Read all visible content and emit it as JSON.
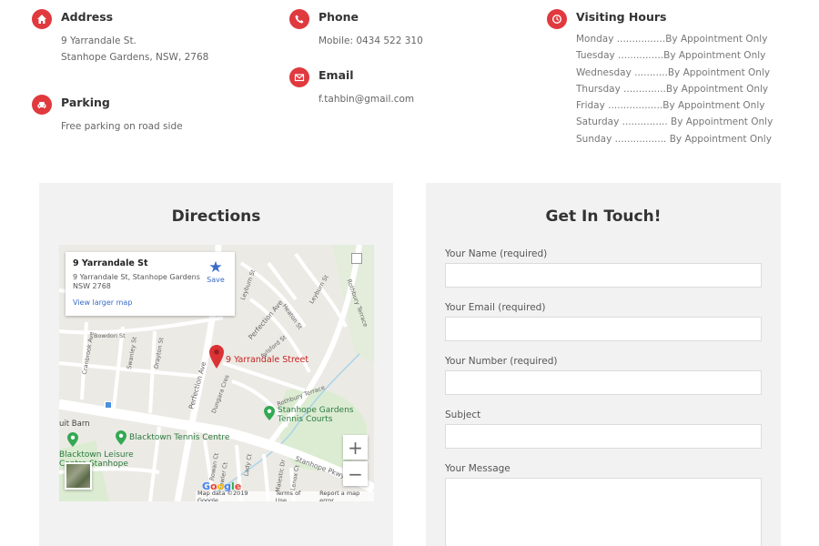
{
  "address": {
    "title": "Address",
    "lines": [
      "9 Yarrandale St.",
      "Stanhope Gardens, NSW, 2768"
    ]
  },
  "parking": {
    "title": "Parking",
    "text": "Free parking on road side"
  },
  "phone": {
    "title": "Phone",
    "text": "Mobile: 0434 522 310"
  },
  "email": {
    "title": "Email",
    "text": "f.tahbin@gmail.com"
  },
  "hours": {
    "title": "Visiting Hours",
    "rows": [
      "Monday ................By Appointment Only",
      "Tuesday ...............By Appointment Only",
      "Wednesday ...........By Appointment Only",
      "Thursday ..............By Appointment Only",
      "Friday ..................By Appointment Only",
      "Saturday ............... By Appointment Only",
      "Sunday ................. By Appointment Only"
    ]
  },
  "directions": {
    "title": "Directions",
    "map": {
      "card_title": "9 Yarrandale St",
      "card_address": "9 Yarrandale St, Stanhope Gardens NSW 2768",
      "save_label": "Save",
      "larger_map_link": "View larger map",
      "pin_label": "9 Yarrandale Street",
      "place_tennis_courts": "Stanhope Gardens Tennis Courts",
      "place_tennis_centre": "Blacktown Tennis Centre",
      "place_leisure": "Blacktown Leisure Centre Stanhope",
      "place_barn": "uit Barn",
      "streets": [
        "Perfection Ave",
        "Perfection Ave",
        "Heaton St",
        "Aylsford St",
        "Rothbury Terrace",
        "Stanhope Pkwy",
        "Leyburn St",
        "Bowdon St",
        "Cranbrook Ave",
        "Swanley St",
        "Drayton St",
        "Dungara Cres",
        "Lady Ct",
        "Malestic Dr",
        "Fowler Ct",
        "Rothbury Terrace",
        "Leyburn St",
        "Rowan Ct",
        "Lenox Ct"
      ],
      "zoom_in": "+",
      "zoom_out": "−",
      "google": "Google",
      "attribution": [
        "Map data ©2019 Google",
        "Terms of Use",
        "Report a map error"
      ]
    }
  },
  "contact": {
    "title": "Get In Touch!",
    "fields": [
      {
        "label": "Your Name (required)"
      },
      {
        "label": "Your Email (required)"
      },
      {
        "label": "Your Number (required)"
      },
      {
        "label": "Subject"
      },
      {
        "label": "Your Message"
      }
    ]
  },
  "colors": {
    "accent": "#e0393e",
    "panel": "#f2f2f2",
    "link": "#3a6bc8",
    "place_green": "#34a853",
    "pin_red": "#db3236"
  }
}
